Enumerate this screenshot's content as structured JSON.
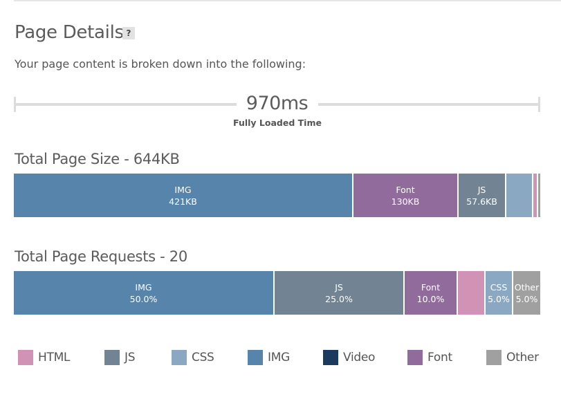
{
  "header": {
    "title": "Page Details",
    "help_label": "?",
    "subtitle": "Your page content is broken down into the following:"
  },
  "timeline": {
    "value": "970ms",
    "label": "Fully Loaded Time"
  },
  "page_size": {
    "title": "Total Page Size - 644KB",
    "segments": [
      {
        "type": "IMG",
        "value": "421KB",
        "color": "#5784aa"
      },
      {
        "type": "Font",
        "value": "130KB",
        "color": "#926b9d"
      },
      {
        "type": "JS",
        "value": "57.6KB",
        "color": "#728393"
      },
      {
        "type": "CSS",
        "value": "",
        "color": "#8aa8c1"
      },
      {
        "type": "HTML",
        "value": "",
        "color": "#d093b5"
      },
      {
        "type": "Other",
        "value": "",
        "color": "#a0a0a0"
      }
    ]
  },
  "page_requests": {
    "title": "Total Page Requests - 20",
    "segments": [
      {
        "type": "IMG",
        "value": "50.0%",
        "color": "#5784aa"
      },
      {
        "type": "JS",
        "value": "25.0%",
        "color": "#728393"
      },
      {
        "type": "Font",
        "value": "10.0%",
        "color": "#926b9d"
      },
      {
        "type": "",
        "value": "",
        "color": "#d093b5"
      },
      {
        "type": "CSS",
        "value": "5.0%",
        "color": "#8aa8c1"
      },
      {
        "type": "Other",
        "value": "5.0%",
        "color": "#a0a0a0"
      }
    ]
  },
  "legend": [
    {
      "label": "HTML",
      "color": "#d093b5"
    },
    {
      "label": "JS",
      "color": "#728393"
    },
    {
      "label": "CSS",
      "color": "#8aa8c1"
    },
    {
      "label": "IMG",
      "color": "#5784aa"
    },
    {
      "label": "Video",
      "color": "#1b3a5e"
    },
    {
      "label": "Font",
      "color": "#926b9d"
    },
    {
      "label": "Other",
      "color": "#a0a0a0"
    }
  ]
}
